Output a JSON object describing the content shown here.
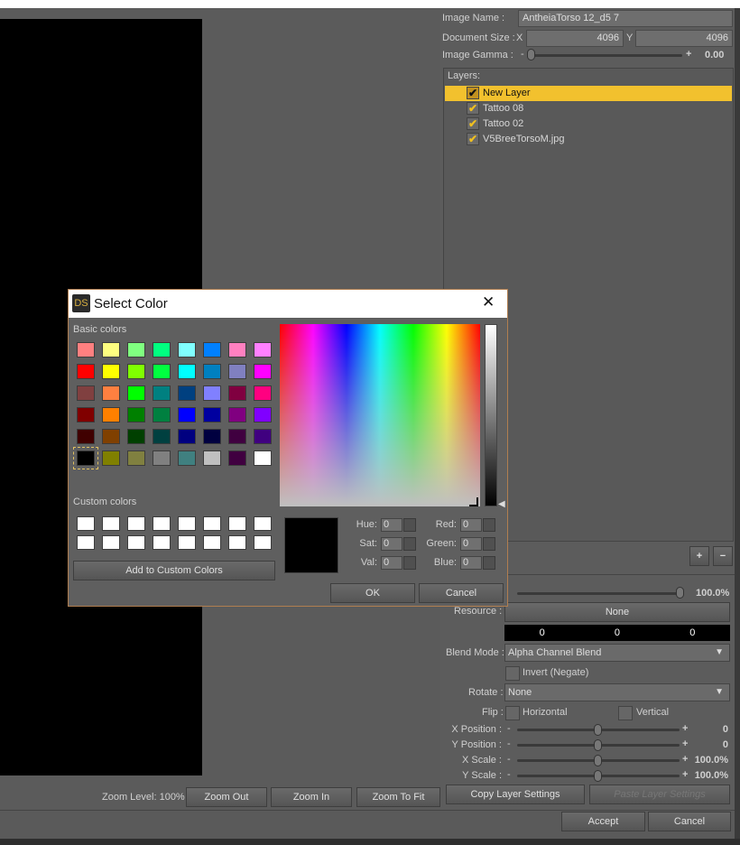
{
  "image_props": {
    "image_name_label": "Image Name :",
    "image_name": "AntheiaTorso 12_d5 7",
    "doc_size_label": "Document Size :",
    "x_label": "X",
    "x_value": "4096",
    "y_label": "Y",
    "y_value": "4096",
    "gamma_label": "Image Gamma :",
    "gamma_value": "0.00",
    "gamma_fraction": 0.0
  },
  "layers": {
    "header": "Layers:",
    "items": [
      {
        "name": "New Layer",
        "checked": true,
        "selected": true
      },
      {
        "name": "Tattoo 08",
        "checked": true
      },
      {
        "name": "Tattoo 02",
        "checked": true
      },
      {
        "name": "V5BreeTorsoM.jpg",
        "checked": true
      }
    ],
    "add_label": "+",
    "remove_label": "−"
  },
  "layer_props": {
    "opacity_value": "100.0%",
    "resource_label": "Resource :",
    "resource_value": "None",
    "color_values": [
      "0",
      "0",
      "0"
    ],
    "blend_label": "Blend Mode :",
    "blend_value": "Alpha Channel Blend",
    "invert_label": "Invert (Negate)",
    "rotate_label": "Rotate :",
    "rotate_value": "None",
    "flip_label": "Flip :",
    "flip_h": "Horizontal",
    "flip_v": "Vertical",
    "xpos_label": "X Position :",
    "xpos_value": "0",
    "ypos_label": "Y Position :",
    "ypos_value": "0",
    "xscale_label": "X Scale :",
    "xscale_value": "100.0%",
    "yscale_label": "Y Scale :",
    "yscale_value": "100.0%",
    "copy_label": "Copy Layer Settings",
    "paste_label": "Paste Layer Settings"
  },
  "footer": {
    "zoom_level": "Zoom Level: 100%",
    "zoom_out": "Zoom Out",
    "zoom_in": "Zoom In",
    "zoom_fit": "Zoom To Fit",
    "accept": "Accept",
    "cancel": "Cancel"
  },
  "dialog": {
    "logo": "DS",
    "title": "Select Color",
    "close": "✕",
    "basic_label": "Basic colors",
    "custom_label": "Custom colors",
    "add_custom": "Add to Custom Colors",
    "basic_colors": [
      "#ff8080",
      "#ffff80",
      "#80ff80",
      "#00ff80",
      "#80ffff",
      "#0080ff",
      "#ff80c0",
      "#ff80ff",
      "#ff0000",
      "#ffff00",
      "#80ff00",
      "#00ff40",
      "#00ffff",
      "#0080c0",
      "#8080c0",
      "#ff00ff",
      "#804040",
      "#ff8040",
      "#00ff00",
      "#008080",
      "#004080",
      "#8080ff",
      "#800040",
      "#ff0080",
      "#800000",
      "#ff8000",
      "#008000",
      "#008040",
      "#0000ff",
      "#0000a0",
      "#800080",
      "#8000ff",
      "#400000",
      "#804000",
      "#004000",
      "#004040",
      "#000080",
      "#000040",
      "#400040",
      "#400080",
      "#000000",
      "#808000",
      "#808040",
      "#808080",
      "#408080",
      "#c0c0c0",
      "#400040",
      "#ffffff"
    ],
    "hue_label": "Hue:",
    "hue": "0",
    "sat_label": "Sat:",
    "sat": "0",
    "val_label": "Val:",
    "val": "0",
    "red_label": "Red:",
    "red": "0",
    "green_label": "Green:",
    "green": "0",
    "blue_label": "Blue:",
    "blue": "0",
    "ok": "OK",
    "cancel": "Cancel",
    "current_color": "#000000"
  }
}
